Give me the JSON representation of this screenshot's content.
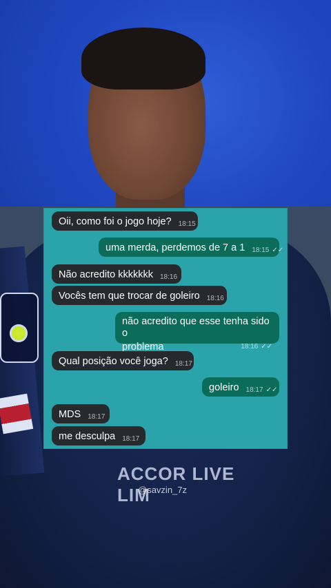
{
  "watermark": "@savzin_7z",
  "background": {
    "sponsor_text": "ACCOR LIVE LIM"
  },
  "chat": {
    "messages": [
      {
        "direction": "in",
        "text": "Oii, como foi o jogo hoje?",
        "time": "18:15"
      },
      {
        "direction": "out",
        "text": "uma merda, perdemos de 7 a 1",
        "time": "18:15",
        "read": "✓✓"
      },
      {
        "direction": "in",
        "text": "Não acredito kkkkkkk",
        "time": "18:16"
      },
      {
        "direction": "in",
        "text": "Vocês tem que trocar de goleiro",
        "time": "18:16"
      },
      {
        "direction": "out",
        "text_line1": "não acredito que esse tenha sido o",
        "text_line2": "problema",
        "time": "18:16",
        "read": "✓✓"
      },
      {
        "direction": "in",
        "text": "Qual posição você joga?",
        "time": "18:17"
      },
      {
        "direction": "out",
        "text": "goleiro",
        "time": "18:17",
        "read": "✓✓"
      },
      {
        "direction": "in",
        "text": "MDS",
        "time": "18:17"
      },
      {
        "direction": "in",
        "text": "me desculpa",
        "time": "18:17"
      }
    ]
  },
  "colors": {
    "panel_bg": "#2aa3aa",
    "incoming_bubble": "#262a2d",
    "outgoing_bubble": "#0b6d59"
  }
}
